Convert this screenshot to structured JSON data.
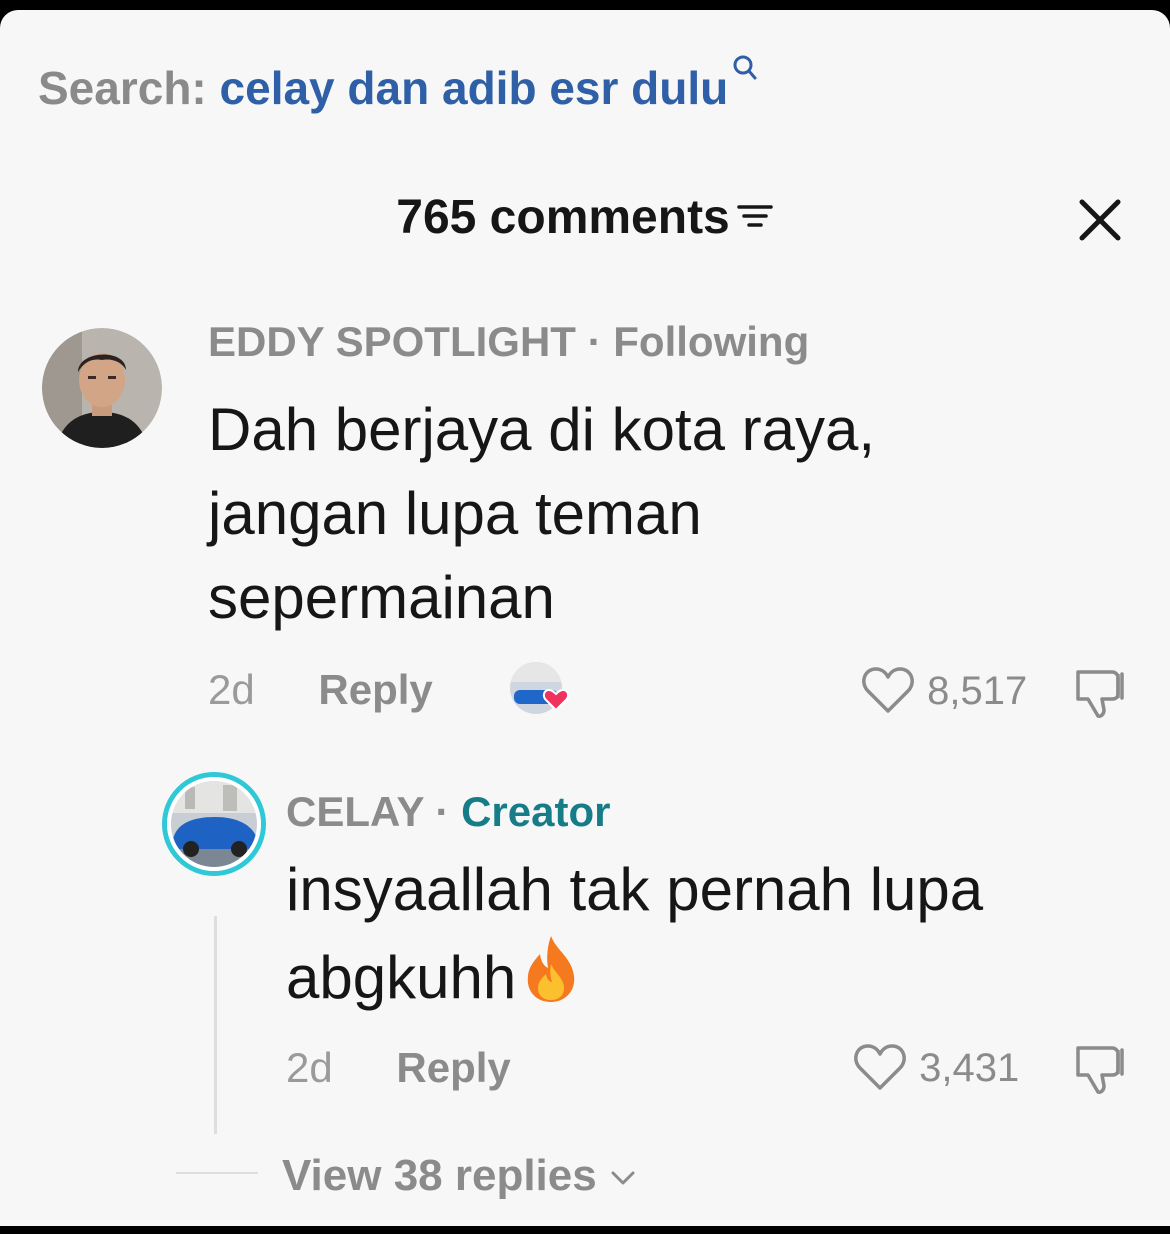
{
  "search": {
    "prefix": "Search:",
    "query": "celay dan adib esr dulu",
    "icon": "search-icon"
  },
  "header": {
    "title": "765 comments",
    "filter_icon": "filter-icon",
    "close_icon": "close-icon"
  },
  "comments": [
    {
      "author": "EDDY SPOTLIGHT",
      "separator": "·",
      "tag": "Following",
      "text_lines": [
        "Dah berjaya di kota raya,",
        "jangan lupa teman",
        "sepermainan"
      ],
      "time": "2d",
      "reply_label": "Reply",
      "likes": "8,517",
      "creator_liked": true
    }
  ],
  "replies": [
    {
      "author": "CELAY",
      "separator": "·",
      "tag": "Creator",
      "text_lines": [
        "insyaallah tak pernah lupa",
        "abgkuhh"
      ],
      "emoji": "🔥",
      "time": "2d",
      "reply_label": "Reply",
      "likes": "3,431"
    }
  ],
  "view_replies": {
    "label": "View 38 replies",
    "icon": "chevron-down-icon"
  },
  "colors": {
    "creator": "#167d88",
    "search_query": "#2f5fa6",
    "heart_badge": "#f0325e",
    "avatar_ring": "#2fc8d6"
  }
}
